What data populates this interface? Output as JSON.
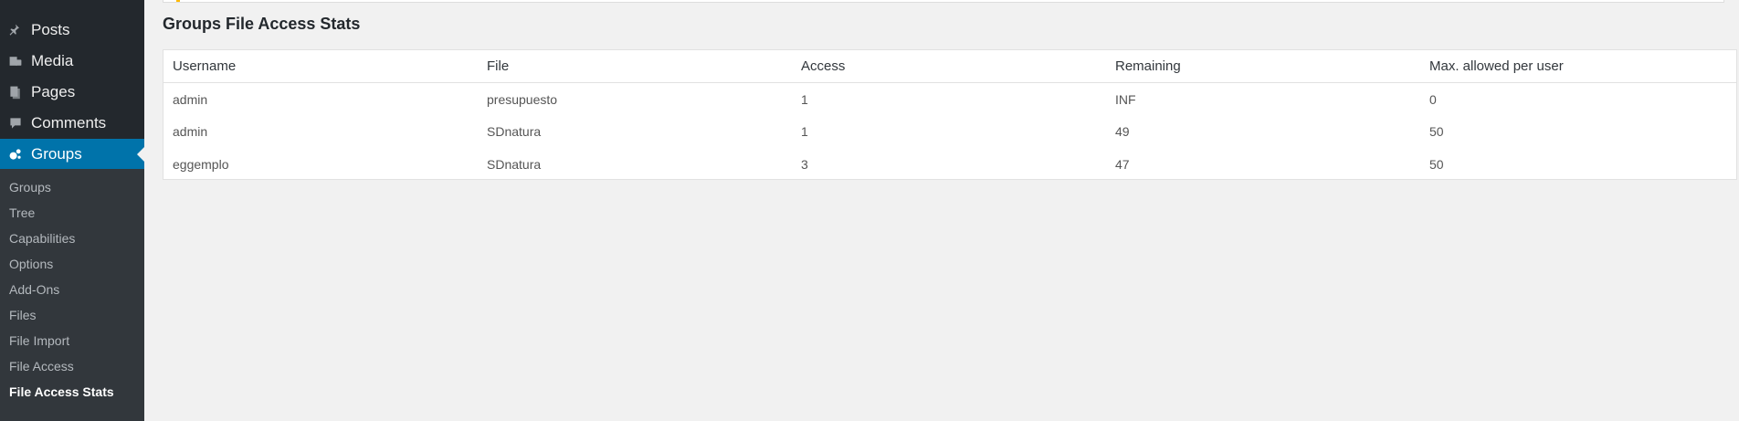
{
  "sidebar": {
    "items": [
      {
        "label": "Posts",
        "icon": "pin-icon"
      },
      {
        "label": "Media",
        "icon": "media-icon"
      },
      {
        "label": "Pages",
        "icon": "pages-icon"
      },
      {
        "label": "Comments",
        "icon": "comments-icon"
      },
      {
        "label": "Groups",
        "icon": "groups-icon",
        "active": true
      }
    ],
    "submenu": [
      "Groups",
      "Tree",
      "Capabilities",
      "Options",
      "Add-Ons",
      "Files",
      "File Import",
      "File Access",
      "File Access Stats"
    ],
    "current_submenu": "File Access Stats"
  },
  "main": {
    "title": "Groups File Access Stats",
    "table": {
      "headers": [
        "Username",
        "File",
        "Access",
        "Remaining",
        "Max. allowed per user"
      ],
      "rows": [
        [
          "admin",
          "presupuesto",
          "1",
          "INF",
          "0"
        ],
        [
          "admin",
          "SDnatura",
          "1",
          "49",
          "50"
        ],
        [
          "eggemplo",
          "SDnatura",
          "3",
          "47",
          "50"
        ]
      ]
    }
  },
  "colors": {
    "sidebar_bg": "#23282d",
    "submenu_bg": "#32373c",
    "active": "#0073aa",
    "notice_accent": "#ffb900"
  }
}
